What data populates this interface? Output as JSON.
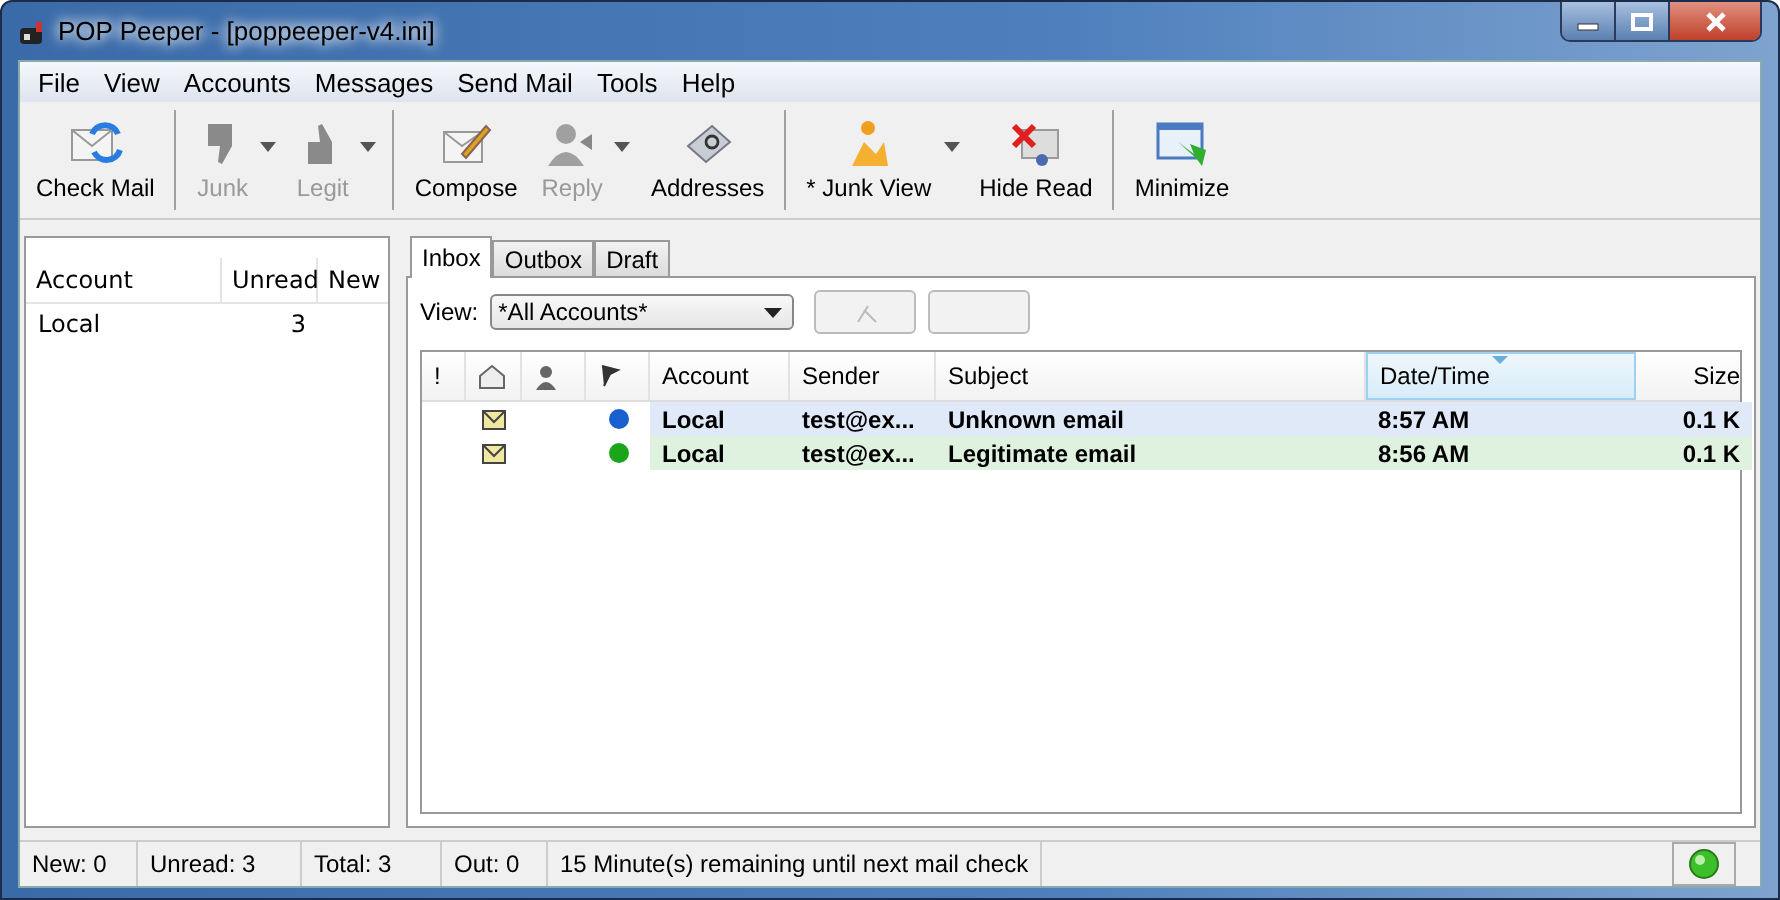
{
  "window": {
    "title": "POP Peeper - [poppeeper-v4.ini]"
  },
  "menu": [
    "File",
    "View",
    "Accounts",
    "Messages",
    "Send Mail",
    "Tools",
    "Help"
  ],
  "toolbar": {
    "groups": [
      [
        {
          "label": "Check Mail",
          "disabled": false,
          "dropdown": false
        }
      ],
      [
        {
          "label": "Junk",
          "disabled": true,
          "dropdown": true
        },
        {
          "label": "Legit",
          "disabled": true,
          "dropdown": true
        }
      ],
      [
        {
          "label": "Compose",
          "disabled": false,
          "dropdown": false
        },
        {
          "label": "Reply",
          "disabled": true,
          "dropdown": true
        },
        {
          "label": "Addresses",
          "disabled": false,
          "dropdown": false
        }
      ],
      [
        {
          "label": "* Junk View",
          "disabled": false,
          "dropdown": true
        },
        {
          "label": "Hide Read",
          "disabled": false,
          "dropdown": false
        }
      ],
      [
        {
          "label": "Minimize",
          "disabled": false,
          "dropdown": false
        }
      ]
    ]
  },
  "accounts": {
    "columns": [
      "Account",
      "Unread",
      "New"
    ],
    "rows": [
      {
        "account": "Local",
        "unread": "3"
      }
    ]
  },
  "tabs": [
    {
      "label": "Inbox",
      "selected": true
    },
    {
      "label": "Outbox",
      "selected": false
    },
    {
      "label": "Draft",
      "selected": false
    }
  ],
  "view": {
    "label": "View:",
    "value": "*All Accounts*"
  },
  "messages": {
    "columns": [
      "!",
      "",
      "",
      "",
      "Account",
      "Sender",
      "Subject",
      "Date/Time",
      "Size"
    ],
    "rows": [
      {
        "color": "#1a5fd0",
        "account": "Local",
        "sender": "test@ex...",
        "subject": "Unknown email",
        "date": "8:57 AM",
        "size": "0.1 K"
      },
      {
        "color": "#1aa51a",
        "account": "Local",
        "sender": "test@ex...",
        "subject": "Legitimate email",
        "date": "8:56 AM",
        "size": "0.1 K"
      }
    ]
  },
  "status_bar": [
    "New: 0",
    "Unread: 3",
    "Total: 3",
    "Out: 0",
    "15 Minute(s) remaining until next mail check"
  ]
}
